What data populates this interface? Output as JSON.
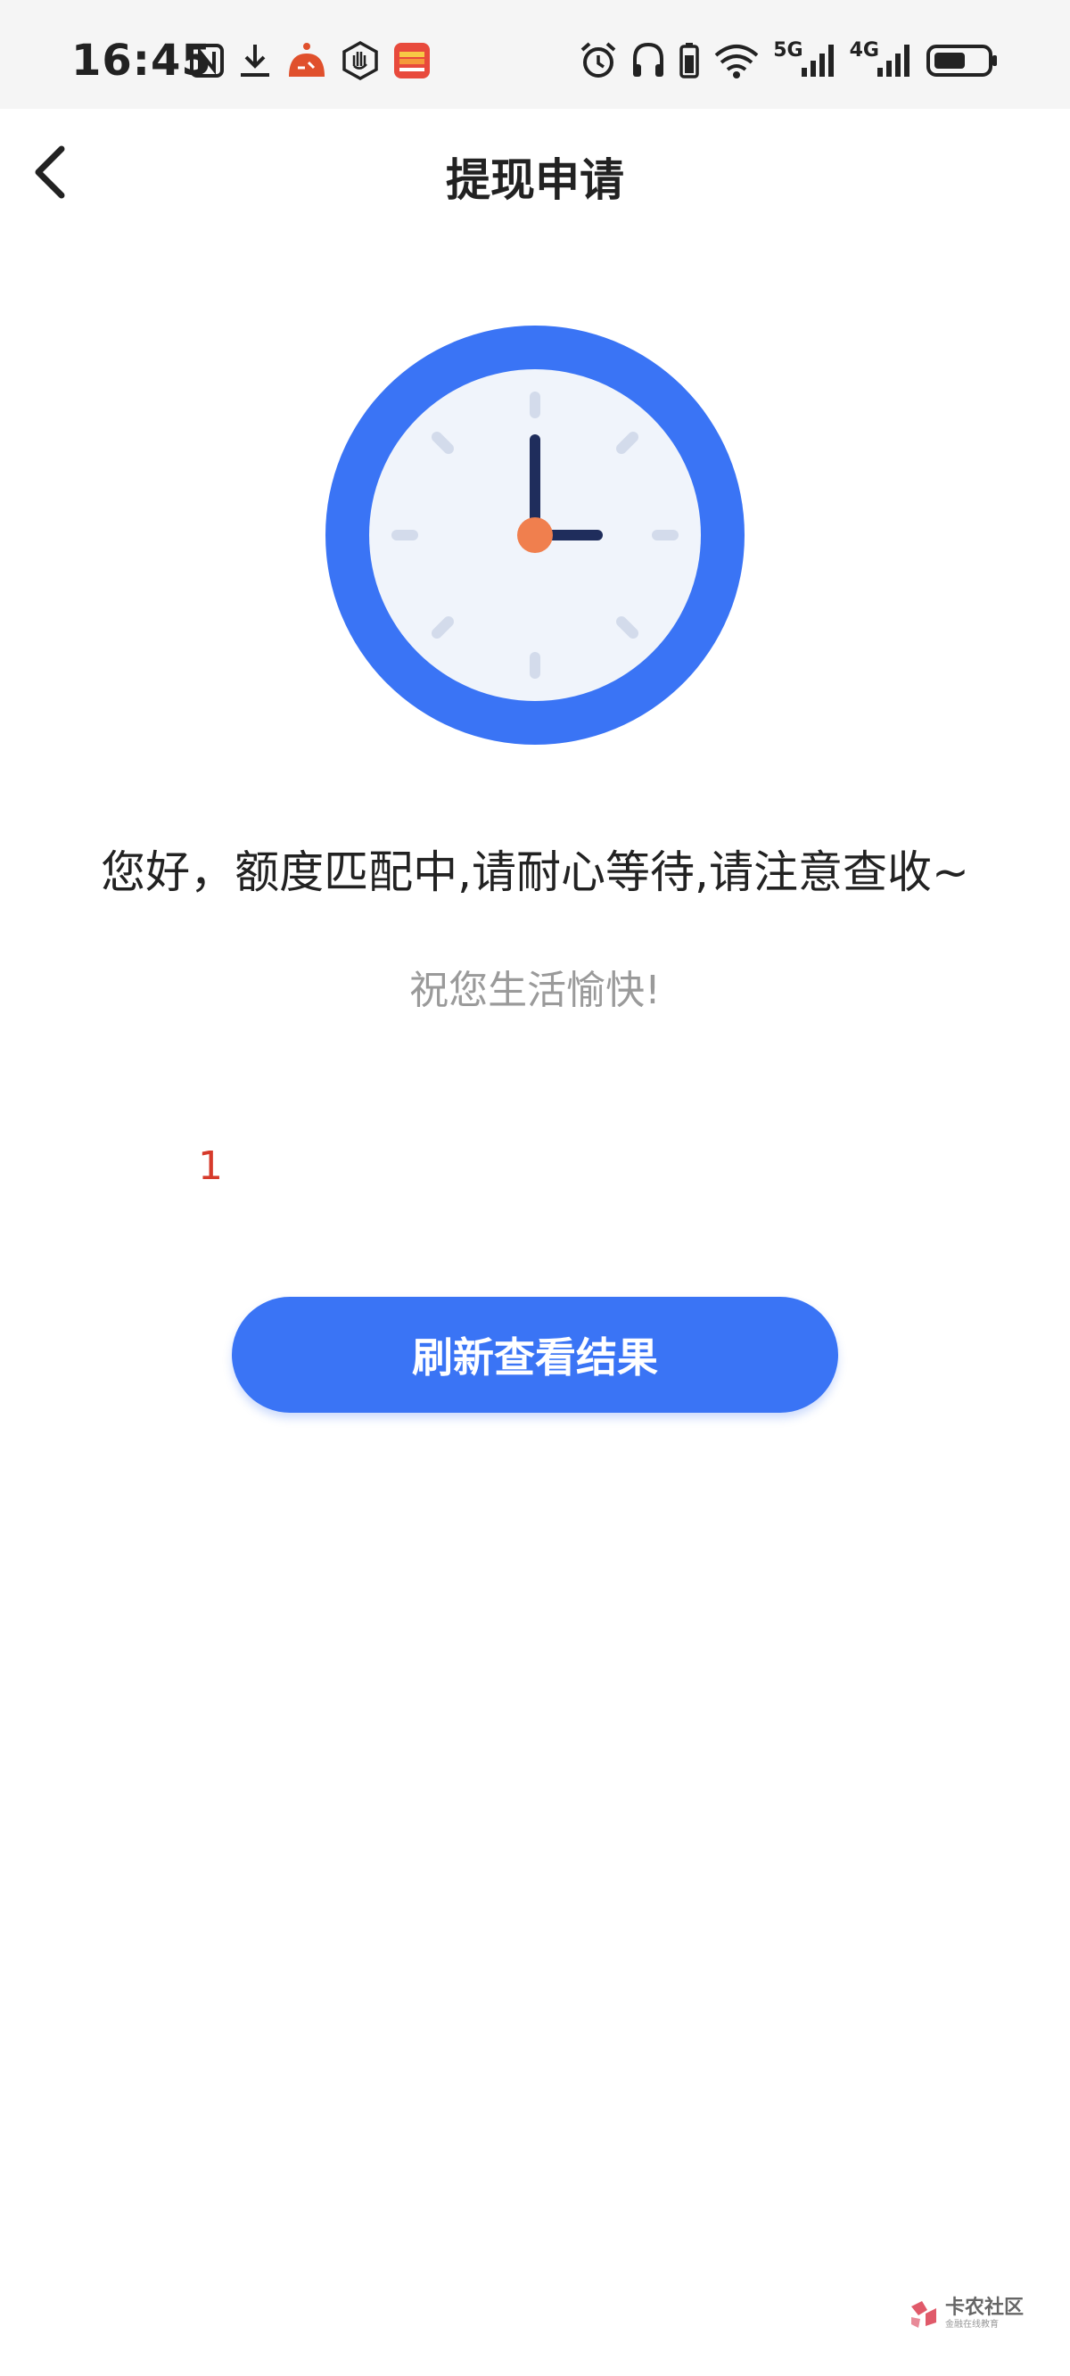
{
  "status_bar": {
    "time": "16:45",
    "left_icons": [
      "nfc-icon",
      "download-icon",
      "app-notification-icon",
      "hand-shield-icon",
      "wallet-app-icon"
    ],
    "right_icons": [
      "alarm-icon",
      "headphones-icon",
      "battery-small-icon",
      "wifi-icon",
      "signal-5g-icon",
      "signal-4g-icon",
      "battery-icon"
    ],
    "network_1": "5G",
    "network_2": "4G"
  },
  "nav": {
    "title": "提现申请"
  },
  "illustration": {
    "icon": "clock-icon",
    "colors": {
      "ring": "#3a74f5",
      "face": "#f0f4fb",
      "hand": "#1f2d5c",
      "center": "#f07f4e",
      "ticks": "#d3dbeb"
    }
  },
  "content": {
    "main_message": "您好，额度匹配中,请耐心等待,请注意查收~",
    "sub_message": "祝您生活愉快!",
    "counter": "1",
    "refresh_button_label": "刷新查看结果"
  },
  "watermark": {
    "main_text": "卡农社区",
    "sub_text": "金融在线教育"
  },
  "colors": {
    "primary": "#3a74f5",
    "counter_red": "#d63a2b",
    "sub_text_gray": "#9a9a9a"
  }
}
